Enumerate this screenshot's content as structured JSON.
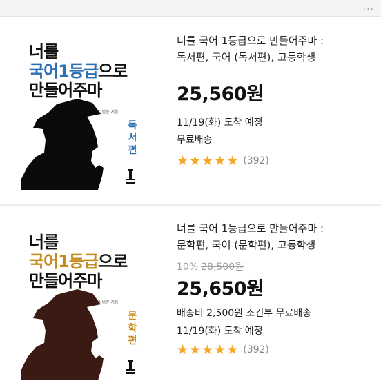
{
  "products": [
    {
      "title_line1": "너를 국어 1등급으로 만들어주마 :",
      "title_line2": "독서편, 국어 (독서편), 고등학생",
      "price": "25,560원",
      "delivery": "11/19(화) 도착 예정",
      "shipping": "무료배송",
      "review_count": "(392)",
      "rating": 5,
      "cover": {
        "line1": "너를",
        "line2_highlight": "국어1등급",
        "line2_rest": "으로",
        "line3": "만들어주마",
        "author": "김범준 지음",
        "edition": [
          "독",
          "서",
          "편"
        ],
        "accent": "#2d6fb3",
        "silhouette": "#0a0a0a"
      }
    },
    {
      "title_line1": "너를 국어 1등급으로 만들어주마 :",
      "title_line2": "문학편, 국어 (문학편), 고등학생",
      "discount_rate": "10%",
      "original_price": "28,500원",
      "price": "25,650원",
      "shipping": "배송비 2,500원 조건부 무료배송",
      "delivery": "11/19(화) 도착 예정",
      "review_count": "(392)",
      "rating": 5,
      "cover": {
        "line1": "너를",
        "line2_highlight": "국어1등급",
        "line2_rest": "으로",
        "line3": "만들어주마",
        "author": "김범준 지음",
        "edition": [
          "문",
          "학",
          "편"
        ],
        "accent": "#c48b1e",
        "silhouette": "#3a1a12"
      }
    }
  ],
  "star_color": "#f5a623",
  "more_menu": "..."
}
